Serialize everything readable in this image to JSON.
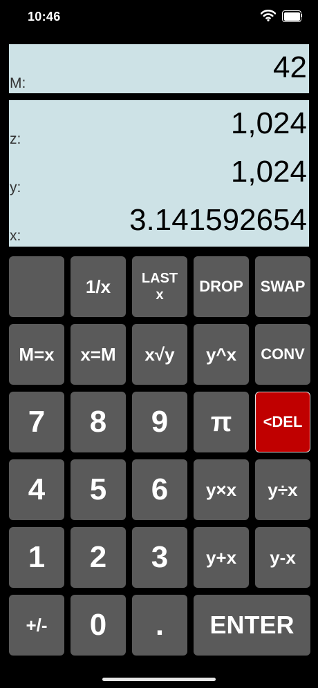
{
  "status": {
    "time": "10:46"
  },
  "display": {
    "memory": {
      "label": "M:",
      "value": "42"
    },
    "stack": [
      {
        "label": "z:",
        "value": "1,024"
      },
      {
        "label": "y:",
        "value": "1,024"
      },
      {
        "label": "x:",
        "value": "3.141592654"
      }
    ]
  },
  "keys": {
    "recip": "1/x",
    "last_line1": "LAST",
    "last_line2": "x",
    "drop": "DROP",
    "swap": "SWAP",
    "m_eq_x": "M=x",
    "x_eq_m": "x=M",
    "root": "x√y",
    "power": "y^x",
    "conv": "CONV",
    "d7": "7",
    "d8": "8",
    "d9": "9",
    "pi": "π",
    "del": "<DEL",
    "d4": "4",
    "d5": "5",
    "d6": "6",
    "mul": "y×x",
    "div": "y÷x",
    "d1": "1",
    "d2": "2",
    "d3": "3",
    "add": "y+x",
    "sub": "y-x",
    "sign": "+/-",
    "d0": "0",
    "dot": ".",
    "enter": "ENTER"
  },
  "colors": {
    "display_bg": "#cde2e6",
    "key_bg": "#5a5a5a",
    "delete_bg": "#c00000"
  }
}
